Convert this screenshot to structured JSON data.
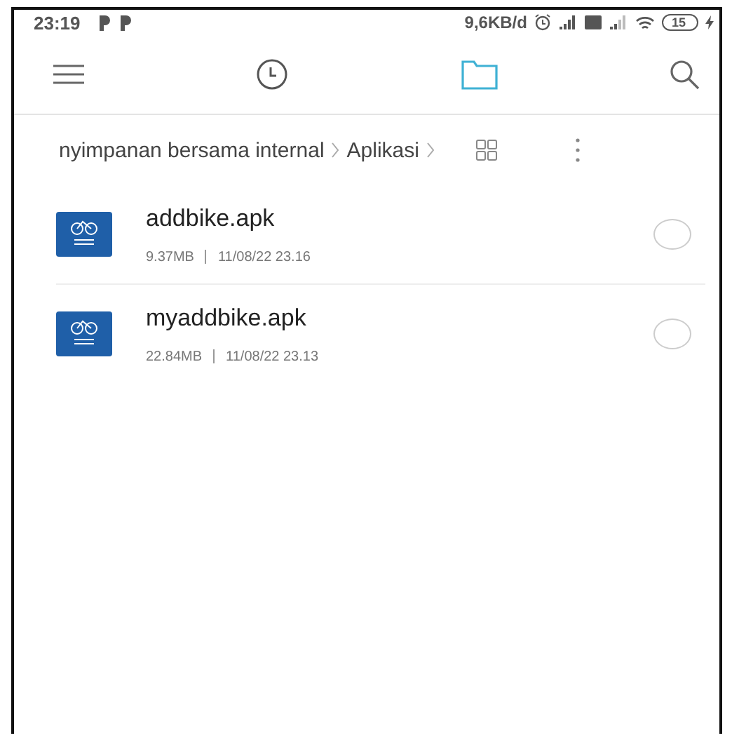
{
  "status_bar": {
    "time": "23:19",
    "speed": "9,6KB/d",
    "battery": "15"
  },
  "toolbar": {
    "tabs": [
      {
        "kind": "recent",
        "selected": false
      },
      {
        "kind": "files",
        "selected": true
      }
    ]
  },
  "breadcrumb": {
    "items": [
      "nyimpanan bersama internal",
      "Aplikasi"
    ]
  },
  "files": [
    {
      "name": "addbike.apk",
      "size": "9.37MB",
      "date": "11/08/22 23.16",
      "checked": false
    },
    {
      "name": "myaddbike.apk",
      "size": "22.84MB",
      "date": "11/08/22 23.13",
      "checked": false
    }
  ]
}
